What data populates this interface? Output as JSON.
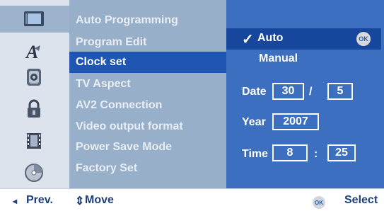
{
  "icons": [
    "tv-general-icon",
    "language-icon",
    "audio-icon",
    "lock-icon",
    "recording-icon",
    "disc-icon"
  ],
  "menu": {
    "items": [
      "Auto Programming",
      "Program Edit",
      "Clock set",
      "TV Aspect",
      "AV2 Connection",
      "Video output format",
      "Power Save Mode",
      "Factory Set"
    ],
    "selected": "Clock set"
  },
  "clock": {
    "auto_label": "Auto",
    "check_glyph": "✓",
    "manual_label": "Manual",
    "ok_label": "OK",
    "date_label": "Date",
    "date_day": "30",
    "date_sep": "/",
    "date_month": "5",
    "year_label": "Year",
    "year_value": "2007",
    "time_label": "Time",
    "time_hour": "8",
    "time_sep": ":",
    "time_minute": "25"
  },
  "footer": {
    "prev_arrow": "◂",
    "prev_label": "Prev.",
    "move_arrow": "⇕",
    "move_label": "Move",
    "ok_label": "OK",
    "select_label": "Select"
  },
  "colors": {
    "left_panel": "#dde3ec",
    "menu_panel": "#98afca",
    "highlight": "#1f56b3",
    "right_panel": "#3c6fbf",
    "auto_row": "#17479c"
  }
}
